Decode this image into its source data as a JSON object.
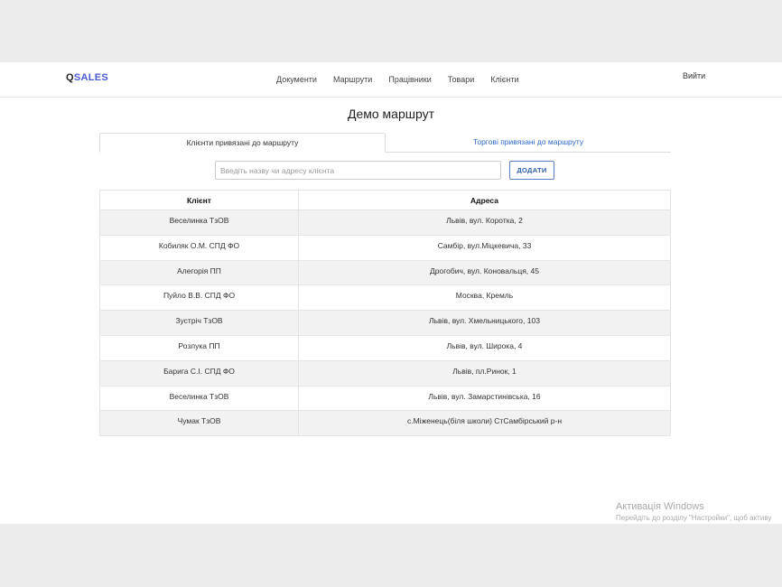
{
  "brand": {
    "q": "Q",
    "sales": "SALES"
  },
  "nav": {
    "items": [
      "Документи",
      "Маршрути",
      "Працівники",
      "Товари",
      "Клієнти"
    ],
    "logout": "Вийти"
  },
  "page_title": "Демо маршрут",
  "tabs": [
    {
      "label": "Клієнти привязані до маршруту",
      "active": true
    },
    {
      "label": "Торгові привязані до маршруту",
      "active": false
    }
  ],
  "search": {
    "placeholder": "Введіть назву чи адресу клієнта",
    "value": ""
  },
  "add_button": "ДОДАТИ",
  "table": {
    "headers": [
      "Клієнт",
      "Адреса"
    ],
    "rows": [
      [
        "Веселинка ТзОВ",
        "Львів, вул. Коротка, 2"
      ],
      [
        "Кобиляк О.М. СПД ФО",
        "Самбір, вул.Міцкевича, 33"
      ],
      [
        "Алегорія ПП",
        "Дрогобич, вул. Коновальця, 45"
      ],
      [
        "Пуйло В.В. СПД ФО",
        "Москва, Кремль"
      ],
      [
        "Зустріч ТзОВ",
        "Львів, вул. Хмельницького, 103"
      ],
      [
        "Розлука ПП",
        "Львів, вул. Широка, 4"
      ],
      [
        "Барига С.І. СПД ФО",
        "Львів, пл.Ринок, 1"
      ],
      [
        "Веселинка ТзОВ",
        "Львів, вул. Замарстинівська, 16"
      ],
      [
        "Чумак ТзОВ",
        "с.Міженець(біля школи) СтСамбірський р-н"
      ]
    ]
  },
  "watermark": {
    "line1": "Активація Windows",
    "line2": "Перейдіть до розділу \"Настройки\", щоб активу"
  }
}
